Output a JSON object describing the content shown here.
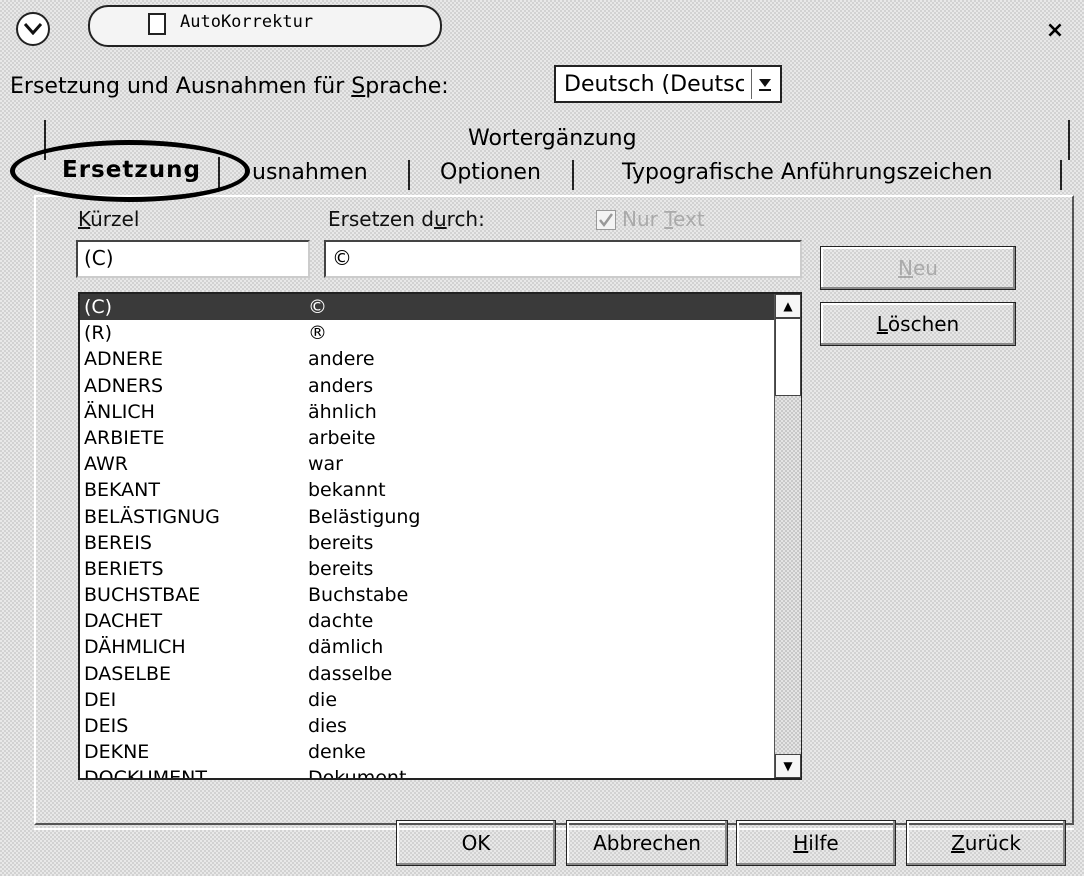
{
  "window": {
    "title": "AutoKorrektur",
    "close_glyph": "×"
  },
  "language": {
    "label_prefix": "Ersetzung und Ausnahmen für ",
    "label_underlined": "S",
    "label_suffix": "prache:",
    "selected": "Deutsch (Deutsc"
  },
  "tabs": {
    "row_top": [
      "Wortergänzung"
    ],
    "row_bottom": [
      "Ersetzung",
      "Ausnahmen",
      "Optionen",
      "Typografische Anführungszeichen"
    ],
    "active": "Ersetzung",
    "partial_visible_ausnahmen": "usnahmen"
  },
  "form": {
    "kurzel_label_u": "K",
    "kurzel_label_rest": "ürzel",
    "ersetzen_label_pre": "Ersetzen d",
    "ersetzen_label_u": "u",
    "ersetzen_label_post": "rch:",
    "nur_text_pre": "Nur ",
    "nur_text_u": "T",
    "nur_text_post": "ext",
    "nur_text_checked": true,
    "kurzel_value": "(C)",
    "ersetzen_value": "©"
  },
  "buttons": {
    "neu_u": "N",
    "neu_rest": "eu",
    "loeschen_u": "L",
    "loeschen_rest": "öschen",
    "ok": "OK",
    "abbrechen": "Abbrechen",
    "hilfe_u": "H",
    "hilfe_rest": "ilfe",
    "zurueck_u": "Z",
    "zurueck_rest": "urück"
  },
  "list": {
    "rows": [
      {
        "short": "(C)",
        "replace": "©",
        "selected": true
      },
      {
        "short": "(R)",
        "replace": "®"
      },
      {
        "short": "ADNERE",
        "replace": "andere"
      },
      {
        "short": "ADNERS",
        "replace": "anders"
      },
      {
        "short": "ÄNLICH",
        "replace": "ähnlich"
      },
      {
        "short": "ARBIETE",
        "replace": "arbeite"
      },
      {
        "short": "AWR",
        "replace": "war"
      },
      {
        "short": "BEKANT",
        "replace": "bekannt"
      },
      {
        "short": "BELÄSTIGNUG",
        "replace": "Belästigung"
      },
      {
        "short": "BEREIS",
        "replace": "bereits"
      },
      {
        "short": "BERIETS",
        "replace": "bereits"
      },
      {
        "short": "BUCHSTBAE",
        "replace": "Buchstabe"
      },
      {
        "short": "DACHET",
        "replace": "dachte"
      },
      {
        "short": "DÄHMLICH",
        "replace": "dämlich"
      },
      {
        "short": "DASELBE",
        "replace": "dasselbe"
      },
      {
        "short": "DEI",
        "replace": "die"
      },
      {
        "short": "DEIS",
        "replace": "dies"
      },
      {
        "short": "DEKNE",
        "replace": "denke"
      },
      {
        "short": "DOCKUMENT",
        "replace": "Dokument"
      }
    ]
  }
}
